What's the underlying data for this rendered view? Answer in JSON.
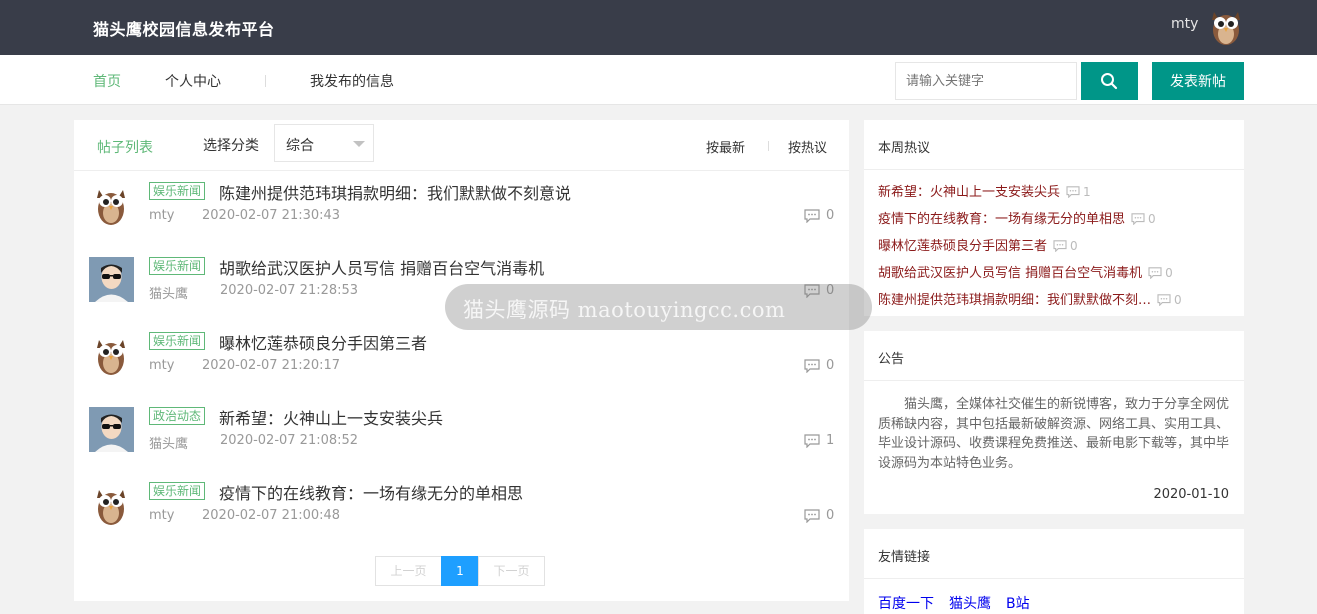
{
  "header": {
    "brand": "猫头鹰校园信息发布平台",
    "user_name": "mty"
  },
  "nav": {
    "items": [
      {
        "label": "首页",
        "active": true
      },
      {
        "label": "个人中心",
        "active": false
      },
      {
        "label": "我发布的信息",
        "active": false
      }
    ],
    "search_placeholder": "请输入关键字",
    "search_icon": "search-icon",
    "post_button": "发表新帖"
  },
  "list": {
    "title": "帖子列表",
    "category_label": "选择分类",
    "category_value": "综合",
    "sort_latest": "按最新",
    "sort_hot": "按热议",
    "posts": [
      {
        "tag": "娱乐新闻",
        "title": "陈建州提供范玮琪捐款明细：我们默默做不刻意说",
        "author": "mty",
        "time": "2020-02-07 21:30:43",
        "comments": "0",
        "avatar": "owl"
      },
      {
        "tag": "娱乐新闻",
        "title": "胡歌给武汉医护人员写信 捐赠百台空气消毒机",
        "author": "猫头鹰",
        "time": "2020-02-07 21:28:53",
        "comments": "0",
        "avatar": "cartoon"
      },
      {
        "tag": "娱乐新闻",
        "title": "曝林忆莲恭硕良分手因第三者",
        "author": "mty",
        "time": "2020-02-07 21:20:17",
        "comments": "0",
        "avatar": "owl"
      },
      {
        "tag": "政治动态",
        "title": "新希望：火神山上一支安装尖兵",
        "author": "猫头鹰",
        "time": "2020-02-07 21:08:52",
        "comments": "1",
        "avatar": "cartoon"
      },
      {
        "tag": "娱乐新闻",
        "title": "疫情下的在线教育：一场有缘无分的单相思",
        "author": "mty",
        "time": "2020-02-07 21:00:48",
        "comments": "0",
        "avatar": "owl"
      }
    ],
    "pager": {
      "prev": "上一页",
      "current": "1",
      "next": "下一页"
    }
  },
  "hot": {
    "title": "本周热议",
    "items": [
      {
        "title": "新希望：火神山上一支安装尖兵",
        "count": "1"
      },
      {
        "title": "疫情下的在线教育：一场有缘无分的单相思",
        "count": "0"
      },
      {
        "title": "曝林忆莲恭硕良分手因第三者",
        "count": "0"
      },
      {
        "title": "胡歌给武汉医护人员写信 捐赠百台空气消毒机",
        "count": "0"
      },
      {
        "title": "陈建州提供范玮琪捐款明细：我们默默做不刻…",
        "count": "0"
      }
    ]
  },
  "notice": {
    "title": "公告",
    "text": "猫头鹰，全媒体社交催生的新锐博客，致力于分享全网优质稀缺内容，其中包括最新破解资源、网络工具、实用工具、毕业设计源码、收费课程免费推送、最新电影下载等，其中毕设源码为本站特色业务。",
    "date": "2020-01-10"
  },
  "links": {
    "title": "友情链接",
    "items": [
      "百度一下",
      "猫头鹰",
      "B站"
    ]
  },
  "watermark": "猫头鹰源码 maotouyingcc.com",
  "colors": {
    "topbar": "#393d49",
    "accent": "#009688",
    "green": "#5fb878",
    "pager": "#1e9fff",
    "hot_link": "#8b1a1a"
  }
}
